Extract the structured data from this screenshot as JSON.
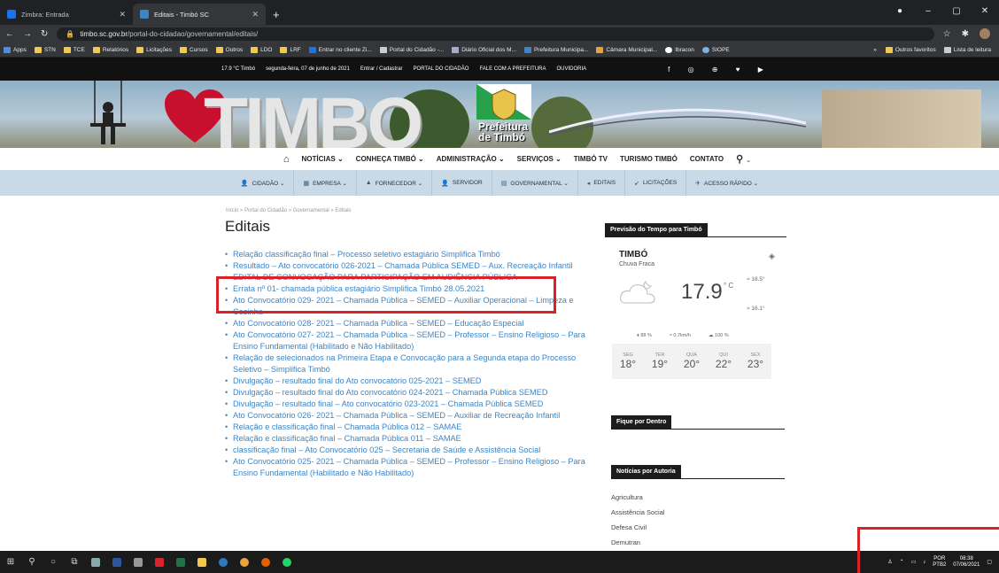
{
  "browser": {
    "tabs": [
      {
        "title": "Zimbra: Entrada",
        "color": "#1a73e8"
      },
      {
        "title": "Editais - Timbó SC",
        "color": "#3d85c6"
      }
    ],
    "new_tab": "+",
    "url_host": "timbo.sc.gov.br",
    "url_path": "/portal-do-cidadao/governamental/editais/",
    "bookmarks": [
      "Apps",
      "STN",
      "TCE",
      "Relatórios",
      "Licitações",
      "Cursos",
      "Outros",
      "LDO",
      "LRF",
      "Entrar no cliente Zi...",
      "Portal do Cidadão -...",
      "Diário Oficial dos M...",
      "Prefeitura Municipa...",
      "Câmara Municipal...",
      "Ibracon",
      "SIOPE"
    ],
    "bookmarks_more": "»",
    "bookmarks_right": [
      "Outros favoritos",
      "Lista de leitura"
    ]
  },
  "site_top": {
    "weather": "17.9 °C  Timbó",
    "date": "segunda-feira, 07 de junho de 2021",
    "links": [
      "Entrar / Cadastrar",
      "PORTAL DO CIDADÃO",
      "FALE COM A PREFEITURA",
      "OUVIDORIA"
    ],
    "social": "f ◎ ⊕ ♥ ▶"
  },
  "banner": {
    "letters": "TIMBO",
    "pref_line1": "Prefeitura",
    "pref_line2": "de Timbó"
  },
  "main_nav": [
    "NOTÍCIAS ⌄",
    "CONHEÇA TIMBÓ ⌄",
    "ADMINISTRAÇÃO ⌄",
    "SERVIÇOS ⌄",
    "TIMBÓ TV",
    "TURISMO TIMBÓ",
    "CONTATO"
  ],
  "sub_nav": [
    {
      "icon": "👤",
      "label": "CIDADÃO ⌄"
    },
    {
      "icon": "▦",
      "label": "EMPRESA ⌄"
    },
    {
      "icon": "▲",
      "label": "FORNECEDOR ⌄"
    },
    {
      "icon": "👤",
      "label": "SERVIDOR"
    },
    {
      "icon": "▤",
      "label": "GOVERNAMENTAL ⌄"
    },
    {
      "icon": "◂",
      "label": "EDITAIS"
    },
    {
      "icon": "➹",
      "label": "LICITAÇÕES"
    },
    {
      "icon": "✈",
      "label": "ACESSO RÁPIDO ⌄"
    }
  ],
  "breadcrumb": "Início » Portal do Cidadão » Governamental » Editais",
  "page_title": "Editais",
  "editais": [
    "Relação classificação final – Processo seletivo estagiário Simplifica Timbó",
    "Resultado – Ato convocatório 026-2021 – Chamada Pública SEMED – Aux. Recreação Infantil",
    "EDITAL DE CONVOCAÇÃO PARA PARTICIPAÇÃO EM AUDIÊNCIA PÚBLICA",
    "Errata nº 01- chamada pública estagiário Simplifica Timbó 28.05.2021",
    "Ato Convocatório 029- 2021 – Chamada Pública – SEMED – Auxiliar Operacional – Limpeza e Cozinha",
    "Ato Convocatório 028- 2021 – Chamada Pública – SEMED – Educação Especial",
    "Ato Convocatório 027- 2021 – Chamada Pública – SEMED – Professor – Ensino Religioso – Para Ensino Fundamental (Habilitado e Não Habilitado)",
    "Relação de selecionados na Primeira Etapa e Convocação para a Segunda etapa do Processo Seletivo – Simplifica Timbó",
    "Divulgação – resultado final do Ato convocatório 025-2021 – SEMED",
    "Divulgação – resultado final do Ato convocatório 024-2021 – Chamada Pública SEMED",
    "Divulgação – resultado final – Ato convocatório 023-2021 – Chamada Pública SEMED",
    "Ato Convocatório 026- 2021 – Chamada Pública – SEMED – Auxiliar de Recreação Infantil",
    "Relação e classificação final – Chamada Pública 012 – SAMAE",
    "Relação e classificação final – Chamada Pública 011 – SAMAE",
    "classificação final – Ato Convocatório 025 – Secretaria de Saúde e Assistência Social",
    "Ato Convocatório 025- 2021 – Chamada Pública – SEMED – Professor – Ensino Religioso – Para Ensino Fundamental (Habilitado e Não Habilitado)"
  ],
  "weather": {
    "header": "Previsão do Tempo para Timbó",
    "city": "TIMBÓ",
    "desc": "Chuva Fraca",
    "temp": "17.9",
    "unit": "° C",
    "hi": "≈ 18.5°",
    "lo": "≈ 16.1°",
    "humidity": "♦ 88 %",
    "wind": "≈ 0.7km/h",
    "clouds": "☁ 100 %",
    "forecast": [
      {
        "day": "SEG",
        "t": "18°"
      },
      {
        "day": "TER",
        "t": "19°"
      },
      {
        "day": "QUA",
        "t": "20°"
      },
      {
        "day": "QUI",
        "t": "22°"
      },
      {
        "day": "SEX",
        "t": "23°"
      }
    ]
  },
  "fique": {
    "header": "Fique por Dentro"
  },
  "noticias": {
    "header": "Notícias por Autoria",
    "items": [
      "Agricultura",
      "Assistência Social",
      "Defesa Civil",
      "Demutran"
    ]
  },
  "taskbar": {
    "lang1": "POR",
    "lang2": "PTB2",
    "time": "08:38",
    "date": "07/06/2021"
  }
}
